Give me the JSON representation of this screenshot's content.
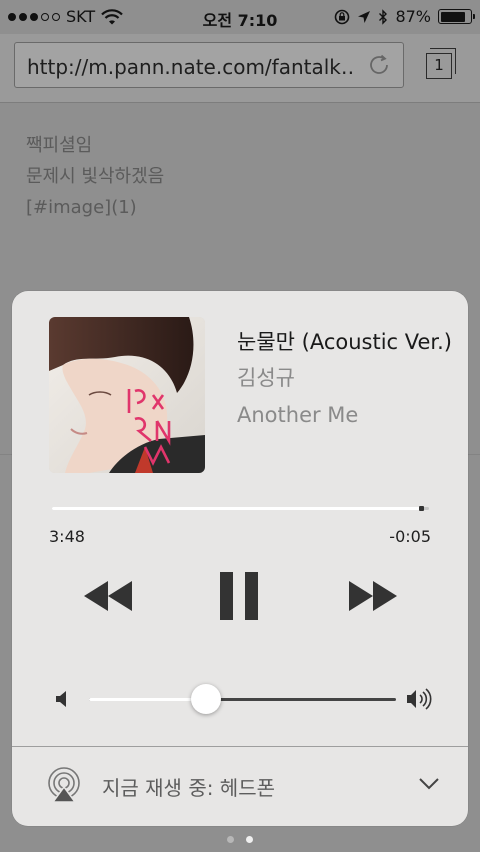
{
  "status_bar": {
    "signal_dots_filled": 3,
    "signal_dots_total": 5,
    "carrier": "SKT",
    "time": "오전 7:10",
    "battery_percent": "87%",
    "battery_level": 0.87
  },
  "browser": {
    "url": "http://m.pann.nate.com/fantalk…",
    "tab_count": "1",
    "article_lines": [
      "짹피셜임",
      "문제시 빛삭하겠음",
      "[#image](1)"
    ]
  },
  "now_playing": {
    "title": "눈물만 (Acoustic Ver.)",
    "artist": "김성규",
    "album": "Another Me",
    "elapsed": "3:48",
    "remaining": "-0:05",
    "progress": 0.98,
    "volume": 0.38,
    "playback_state": "playing"
  },
  "airplay": {
    "label": "지금 재생 중: 헤드폰"
  },
  "page_indicator": {
    "count": 2,
    "current": 2
  },
  "icons": [
    "wifi-icon",
    "orientation-lock-icon",
    "location-arrow-icon",
    "bluetooth-icon",
    "battery-icon",
    "reload-icon",
    "tabs-icon",
    "rewind-icon",
    "pause-icon",
    "fast-forward-icon",
    "volume-min-icon",
    "volume-max-icon",
    "airplay-icon",
    "chevron-down-icon"
  ]
}
